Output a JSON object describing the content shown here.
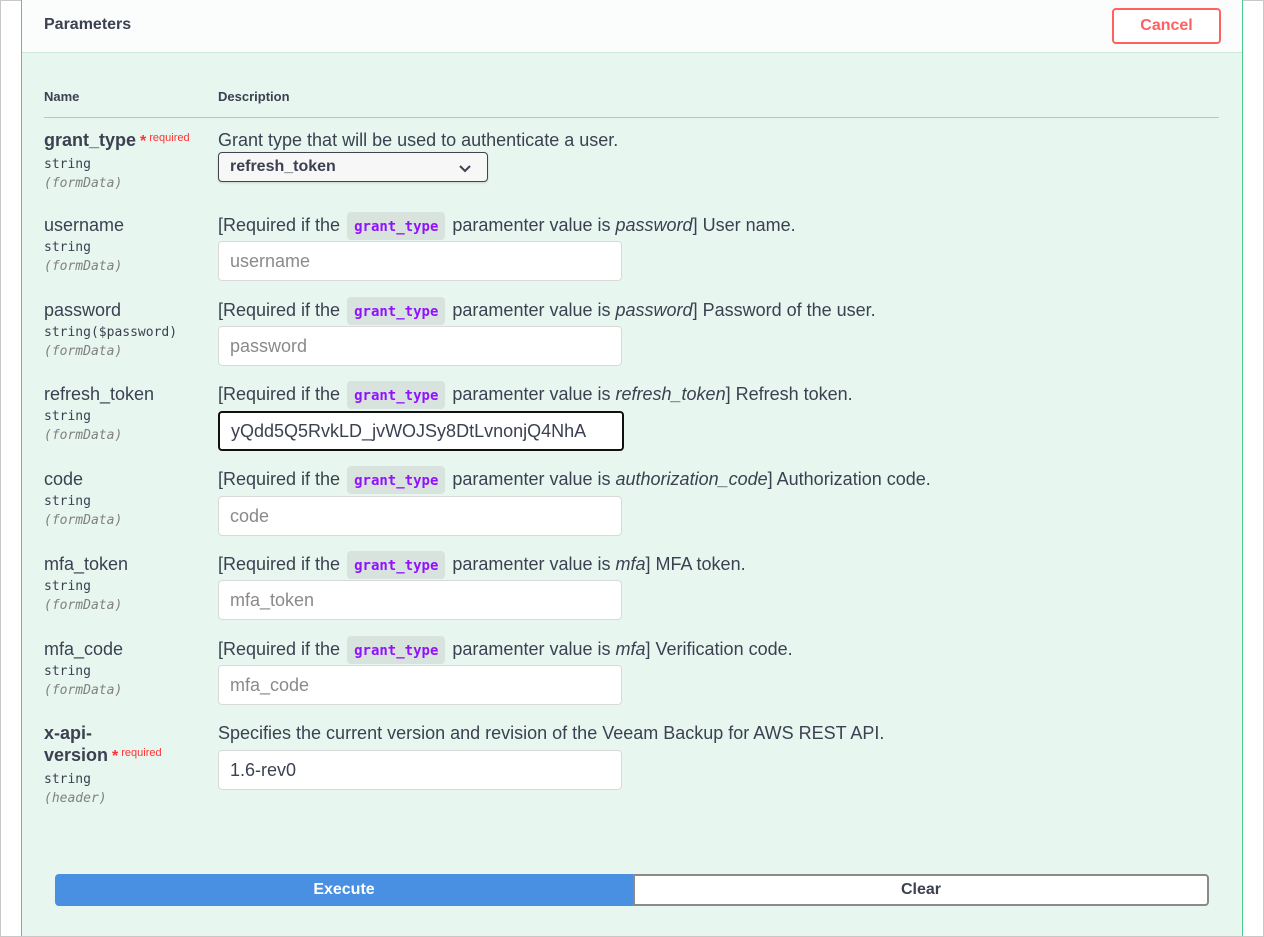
{
  "header": {
    "title": "Parameters",
    "cancel_label": "Cancel"
  },
  "columns": {
    "name": "Name",
    "description": "Description"
  },
  "required_label": "required",
  "star": "*",
  "chip_label": "grant_type",
  "params": {
    "grant_type": {
      "name": "grant_type",
      "type": "string",
      "in": "(formData)",
      "desc": "Grant type that will be used to authenticate a user.",
      "selected": "refresh_token"
    },
    "username": {
      "name": "username",
      "type": "string",
      "in": "(formData)",
      "desc_pre": "[Required if the",
      "desc_mid": "paramenter value is",
      "desc_val": "password",
      "desc_post": "] User name.",
      "placeholder": "username"
    },
    "password": {
      "name": "password",
      "type": "string($password)",
      "in": "(formData)",
      "desc_pre": "[Required if the",
      "desc_mid": "paramenter value is",
      "desc_val": "password",
      "desc_post": "] Password of the user.",
      "placeholder": "password"
    },
    "refresh_token": {
      "name": "refresh_token",
      "type": "string",
      "in": "(formData)",
      "desc_pre": "[Required if the",
      "desc_mid": "paramenter value is",
      "desc_val": "refresh_token",
      "desc_post": "] Refresh token.",
      "value": "yQdd5Q5RvkLD_jvWOJSy8DtLvnonjQ4NhA"
    },
    "code": {
      "name": "code",
      "type": "string",
      "in": "(formData)",
      "desc_pre": "[Required if the",
      "desc_mid": "paramenter value is",
      "desc_val": "authorization_code",
      "desc_post": "] Authorization code.",
      "placeholder": "code"
    },
    "mfa_token": {
      "name": "mfa_token",
      "type": "string",
      "in": "(formData)",
      "desc_pre": "[Required if the",
      "desc_mid": "paramenter value is",
      "desc_val": "mfa",
      "desc_post": "] MFA token.",
      "placeholder": "mfa_token"
    },
    "mfa_code": {
      "name": "mfa_code",
      "type": "string",
      "in": "(formData)",
      "desc_pre": "[Required if the",
      "desc_mid": "paramenter value is",
      "desc_val": "mfa",
      "desc_post": "] Verification code.",
      "placeholder": "mfa_code"
    },
    "x_api_version": {
      "name_line1": "x-api-",
      "name_line2": "version",
      "type": "string",
      "in": "(header)",
      "desc": "Specifies the current version and revision of the Veeam Backup for AWS REST API.",
      "value": "1.6-rev0"
    }
  },
  "actions": {
    "execute_label": "Execute",
    "clear_label": "Clear"
  },
  "icons": {
    "select_arrow": "chevron-down-icon"
  }
}
